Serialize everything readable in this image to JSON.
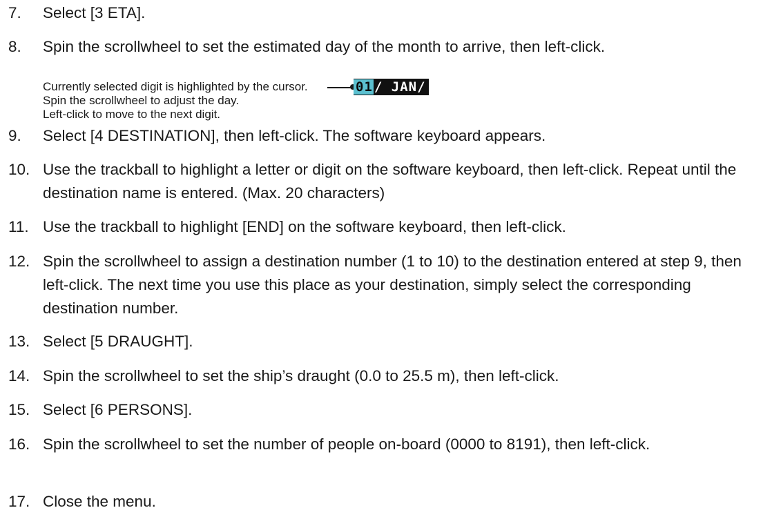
{
  "steps": [
    {
      "num": "7.",
      "text": "Select [3 ETA]."
    },
    {
      "num": "8.",
      "text": "Spin the scrollwheel to set the estimated day of the month to arrive, then left-click."
    },
    {
      "num": "9.",
      "text": "Select [4 DESTINATION], then left-click. The software keyboard appears."
    },
    {
      "num": "10.",
      "text": "Use the trackball to highlight a letter or digit on the software keyboard, then left-click. Repeat until the destination name is entered. (Max. 20 characters)"
    },
    {
      "num": "11.",
      "text": "Use the trackball to highlight [END] on the software keyboard, then left-click."
    },
    {
      "num": "12.",
      "text": "Spin the scrollwheel to assign a destination number (1 to 10) to the destination entered at step 9, then left-click. The next time you use this place as your destination, simply select the corresponding destination number."
    },
    {
      "num": "13.",
      "text": "Select [5 DRAUGHT]."
    },
    {
      "num": "14.",
      "text": "Spin the scrollwheel to set the ship’s draught (0.0 to 25.5 m), then left-click."
    },
    {
      "num": "15.",
      "text": "Select [6 PERSONS]."
    },
    {
      "num": "16.",
      "text": "Spin the scrollwheel to set the number of people on-board (0000 to 8191), then left-click."
    },
    {
      "num": "17.",
      "text": "Close the menu."
    }
  ],
  "note": {
    "line1": "Currently selected digit is highlighted by the cursor.",
    "line2": "Spin the scrollwheel to adjust the day.",
    "line3": "Left-click to move to the next digit."
  },
  "eta_display": {
    "selected": "01",
    "rest": "/ JAN/"
  },
  "colors": {
    "cursor_highlight": "#5bc0d0",
    "display_background": "#111111"
  }
}
